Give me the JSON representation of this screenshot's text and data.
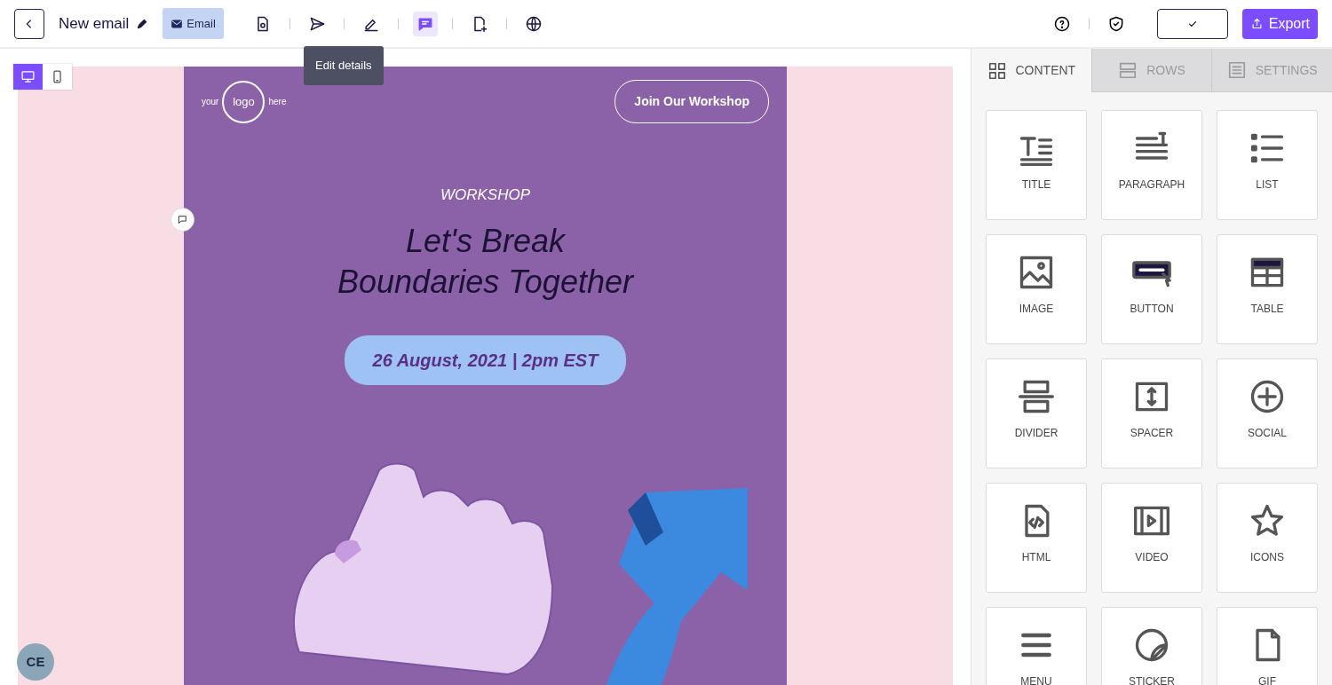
{
  "header": {
    "title": "New email",
    "type_badge": "Email",
    "tools": [
      {
        "kind": "preview",
        "selected": false
      },
      {
        "kind": "send",
        "selected": false
      },
      {
        "kind": "edit",
        "selected": false
      },
      {
        "kind": "comment",
        "selected": true
      },
      {
        "kind": "duplicate",
        "selected": false
      },
      {
        "kind": "globe",
        "selected": false
      }
    ],
    "tooltip": "Edit details",
    "export_label": "Export"
  },
  "devices": [
    {
      "kind": "desktop",
      "selected": true
    },
    {
      "kind": "mobile",
      "selected": false
    }
  ],
  "email": {
    "logo": [
      "your",
      "logo",
      "here"
    ],
    "cta": "Join Our Workshop",
    "eyebrow": "WORKSHOP",
    "headline": [
      "Let's Break",
      "Boundaries Together"
    ],
    "date": "26 August, 2021 | 2pm EST"
  },
  "avatar": "CE",
  "sidebar": {
    "tabs": [
      {
        "label": "CONTENT",
        "kind": "grid",
        "selected": true
      },
      {
        "label": "ROWS",
        "kind": "rows",
        "selected": false
      },
      {
        "label": "SETTINGS",
        "kind": "doc",
        "selected": false
      }
    ],
    "blocks": [
      {
        "label": "TITLE",
        "kind": "title"
      },
      {
        "label": "PARAGRAPH",
        "kind": "paragraph"
      },
      {
        "label": "LIST",
        "kind": "list"
      },
      {
        "label": "IMAGE",
        "kind": "image"
      },
      {
        "label": "BUTTON",
        "kind": "button"
      },
      {
        "label": "TABLE",
        "kind": "table"
      },
      {
        "label": "DIVIDER",
        "kind": "divider"
      },
      {
        "label": "SPACER",
        "kind": "spacer"
      },
      {
        "label": "SOCIAL",
        "kind": "social"
      },
      {
        "label": "HTML",
        "kind": "html"
      },
      {
        "label": "VIDEO",
        "kind": "video"
      },
      {
        "label": "ICONS",
        "kind": "icons"
      },
      {
        "label": "MENU",
        "kind": "menu"
      },
      {
        "label": "STICKER",
        "kind": "sticker"
      },
      {
        "label": "GIF",
        "kind": "gif"
      }
    ]
  }
}
